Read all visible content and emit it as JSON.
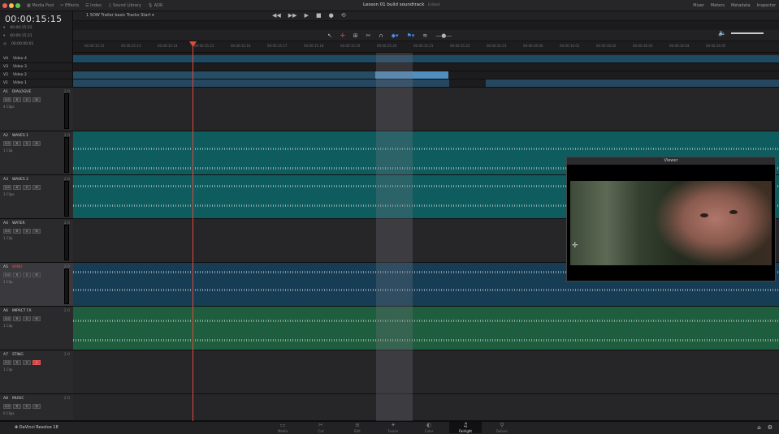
{
  "window": {
    "title": "Lesson 01 build soundtrack",
    "subtitle": "Edited",
    "traffic_colors": [
      "#ee5f57",
      "#f5be4f",
      "#5cc94a"
    ]
  },
  "topbar": {
    "left_items": [
      "Media Pool",
      "Effects",
      "Index",
      "Sound Library",
      "ADR"
    ],
    "right_items": [
      "Mixer",
      "Meters",
      "Metadata",
      "Inspector"
    ]
  },
  "timecode": {
    "main": "00:00:15:15",
    "rows": [
      "00:00:15:22",
      "00:00:15:21",
      "00:00:00:01"
    ]
  },
  "timeline": {
    "name": "1 SOW Trailer basic Tracks Start",
    "ruler": [
      "00:00:15:12",
      "00:00:15:13",
      "00:00:15:14",
      "00:00:15:15",
      "00:00:15:16",
      "00:00:15:17",
      "00:00:15:18",
      "00:00:15:19",
      "00:00:15:20",
      "00:00:15:21",
      "00:00:15:22",
      "00:00:15:23",
      "00:00:16:00",
      "00:00:16:01",
      "00:00:16:02",
      "00:00:16:03",
      "00:00:16:04",
      "00:00:16:05"
    ]
  },
  "video_tracks": [
    {
      "id": "V4",
      "name": "Video 4"
    },
    {
      "id": "V3",
      "name": "Video 3"
    },
    {
      "id": "V2",
      "name": "Video 2"
    },
    {
      "id": "V1",
      "name": "Video 1"
    }
  ],
  "audio_tracks": [
    {
      "id": "A1",
      "name": "DIALOGUE",
      "ch": "2.0",
      "vol": "0.0",
      "sub": "4 Clips"
    },
    {
      "id": "A2",
      "name": "WAVES 1",
      "ch": "2.0",
      "vol": "0.0",
      "sub": "1 Clip"
    },
    {
      "id": "A3",
      "name": "WAVES 2",
      "ch": "2.0",
      "vol": "0.0",
      "sub": "3 Clips"
    },
    {
      "id": "A4",
      "name": "WATER",
      "ch": "2.0",
      "vol": "0.0",
      "sub": "1 Clip"
    },
    {
      "id": "A5",
      "name": "WIND",
      "ch": "2.0",
      "vol": "0.0",
      "sub": "1 Clip"
    },
    {
      "id": "A6",
      "name": "IMPACT FX",
      "ch": "2.0",
      "vol": "0.0",
      "sub": "1 Clip"
    },
    {
      "id": "A7",
      "name": "STING",
      "ch": "2.0",
      "vol": "0.0",
      "sub": "1 Clip"
    },
    {
      "id": "A8",
      "name": "MUSIC",
      "ch": "2.0",
      "vol": "0.0",
      "sub": "0 Clips"
    }
  ],
  "viewer": {
    "title": "Viewer"
  },
  "footer": {
    "brand": "DaVinci Resolve 18",
    "pages": [
      "Media",
      "Cut",
      "Edit",
      "Fusion",
      "Color",
      "Fairlight",
      "Deliver"
    ],
    "active": "Fairlight"
  }
}
